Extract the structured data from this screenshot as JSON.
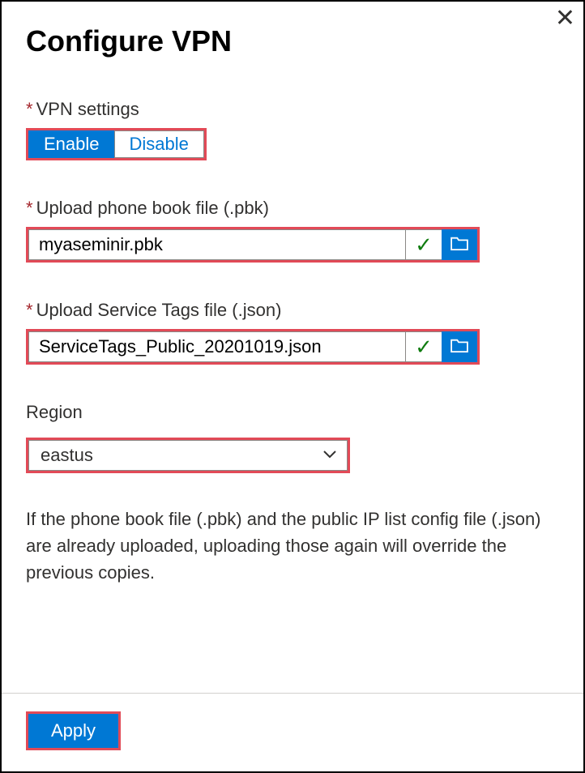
{
  "header": {
    "title": "Configure VPN"
  },
  "vpn": {
    "label": "VPN settings",
    "enable": "Enable",
    "disable": "Disable",
    "selected": "Enable"
  },
  "pbk": {
    "label": "Upload phone book file (.pbk)",
    "value": "myaseminir.pbk",
    "status_icon": "✓"
  },
  "tags": {
    "label": "Upload Service Tags file (.json)",
    "value": "ServiceTags_Public_20201019.json",
    "status_icon": "✓"
  },
  "region": {
    "label": "Region",
    "value": "eastus"
  },
  "note": "If the phone book file (.pbk) and the public IP list config file (.json) are already uploaded, uploading those again will override the previous copies.",
  "footer": {
    "apply": "Apply"
  }
}
